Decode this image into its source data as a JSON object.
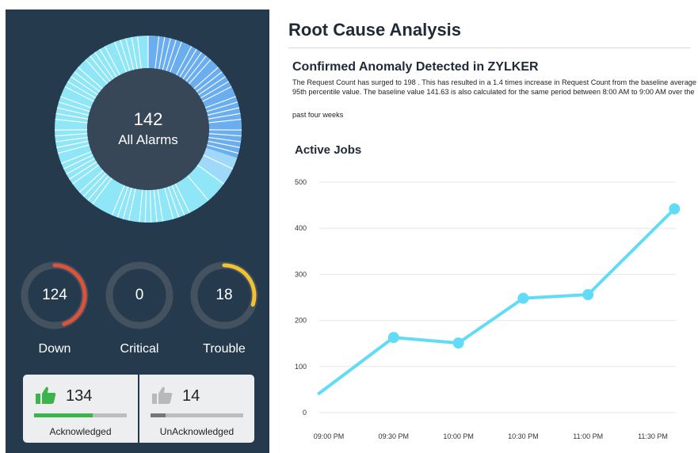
{
  "alarms": {
    "total": "142",
    "label": "All Alarms",
    "ring_colors": [
      "#8ee6f7",
      "#6aaef0",
      "#ffffff"
    ]
  },
  "gauges": [
    {
      "value": "124",
      "label": "Down",
      "fraction": 0.45,
      "color": "#e0513a"
    },
    {
      "value": "0",
      "label": "Critical",
      "fraction": 0,
      "color": "#ffffff"
    },
    {
      "value": "18",
      "label": "Trouble",
      "fraction": 0.3,
      "color": "#f2c230"
    }
  ],
  "acknowledgement": {
    "acknowledged": {
      "count": "134",
      "label": "Acknowledged",
      "fraction": 0.63,
      "color": "#3cb44b"
    },
    "unacknowledged": {
      "count": "14",
      "label": "UnAcknowledged",
      "fraction": 0.16,
      "color": "#777777"
    }
  },
  "rca": {
    "title": "Root Cause Analysis",
    "anomaly_title": "Confirmed Anomaly Detected in ZYLKER",
    "description": "The Request Count has surged to 198 . This has resulted in a 1.4 times increase in  Request Count from the baseline average 95th percentile value. The baseline value 141.63 is also calculated for the same period between 8:00 AM to 9:00 AM over the",
    "description_tail": "past four weeks"
  },
  "chart_data": {
    "type": "line",
    "title": "Active Jobs",
    "xlabel": "",
    "ylabel": "",
    "categories": [
      "09:00 PM",
      "09:30 PM",
      "10:00 PM",
      "10:30 PM",
      "11:00 PM",
      "11:30 PM"
    ],
    "yticks": [
      0,
      100,
      200,
      300,
      400,
      500
    ],
    "ylim": [
      0,
      500
    ],
    "grid": true,
    "color": "#62dcf6",
    "points": [
      {
        "x": "08:55 PM",
        "y": 40
      },
      {
        "x": "09:30 PM",
        "y": 163
      },
      {
        "x": "10:00 PM",
        "y": 151
      },
      {
        "x": "10:30 PM",
        "y": 248
      },
      {
        "x": "11:00 PM",
        "y": 256
      },
      {
        "x": "11:40 PM",
        "y": 442
      }
    ]
  }
}
